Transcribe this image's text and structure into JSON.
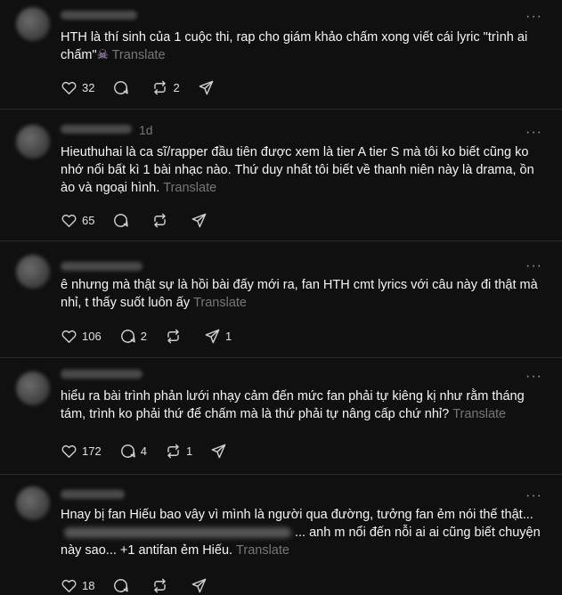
{
  "posts": [
    {
      "time": "",
      "text": "HTH là thí sinh của 1 cuộc thi, rap cho giám khảo chấm xong viết cái lyric \"trình ai chấm\"",
      "emoji": "☠",
      "text_after": "",
      "translate": "Translate",
      "likes": "32",
      "replies": "",
      "reposts": "2",
      "shares": ""
    },
    {
      "time": "1d",
      "text": "Hieuthuhai là ca sĩ/rapper đầu tiên được xem là tier A tier S mà tôi ko biết cũng ko nhớ nổi bất kì 1 bài nhạc nào. Thứ duy nhất tôi biết về thanh niên này là drama, ồn ào và ngoại hình.",
      "emoji": "",
      "text_after": "",
      "translate": "Translate",
      "likes": "65",
      "replies": "",
      "reposts": "",
      "shares": ""
    },
    {
      "time": "",
      "text": "ê nhưng mà thật sự là hồi bài đấy mới ra, fan HTH cmt lyrics với câu này đi thật mà nhỉ, t thấy suốt luôn ấy",
      "emoji": "",
      "text_after": "",
      "translate": "Translate",
      "likes": "106",
      "replies": "2",
      "reposts": "",
      "shares": "1"
    },
    {
      "time": "",
      "text": "hiểu ra bài trình phản lưới nhạy cảm đến mức fan phải tự kiêng kị như rằm tháng tám, trình ko phải thứ để chấm mà là thứ phải tự nâng cấp chứ nhỉ?",
      "emoji": "",
      "text_after": "",
      "translate": "Translate",
      "likes": "172",
      "replies": "4",
      "reposts": "1",
      "shares": ""
    },
    {
      "time": "",
      "text": "Hnay bị fan Hiếu bao vây vì mình là người qua đường, tưởng fan ẻm nói thế thật...",
      "emoji": "",
      "text_after": "... anh m nổi đến nỗi ai ai cũng biết chuyện này sao... +1 antifan ẻm Hiếu.",
      "translate": "Translate",
      "likes": "18",
      "replies": "",
      "reposts": "",
      "shares": ""
    }
  ],
  "icons": {
    "more": "more-icon",
    "like": "heart-icon",
    "reply": "comment-icon",
    "repost": "repost-icon",
    "share": "share-icon"
  }
}
